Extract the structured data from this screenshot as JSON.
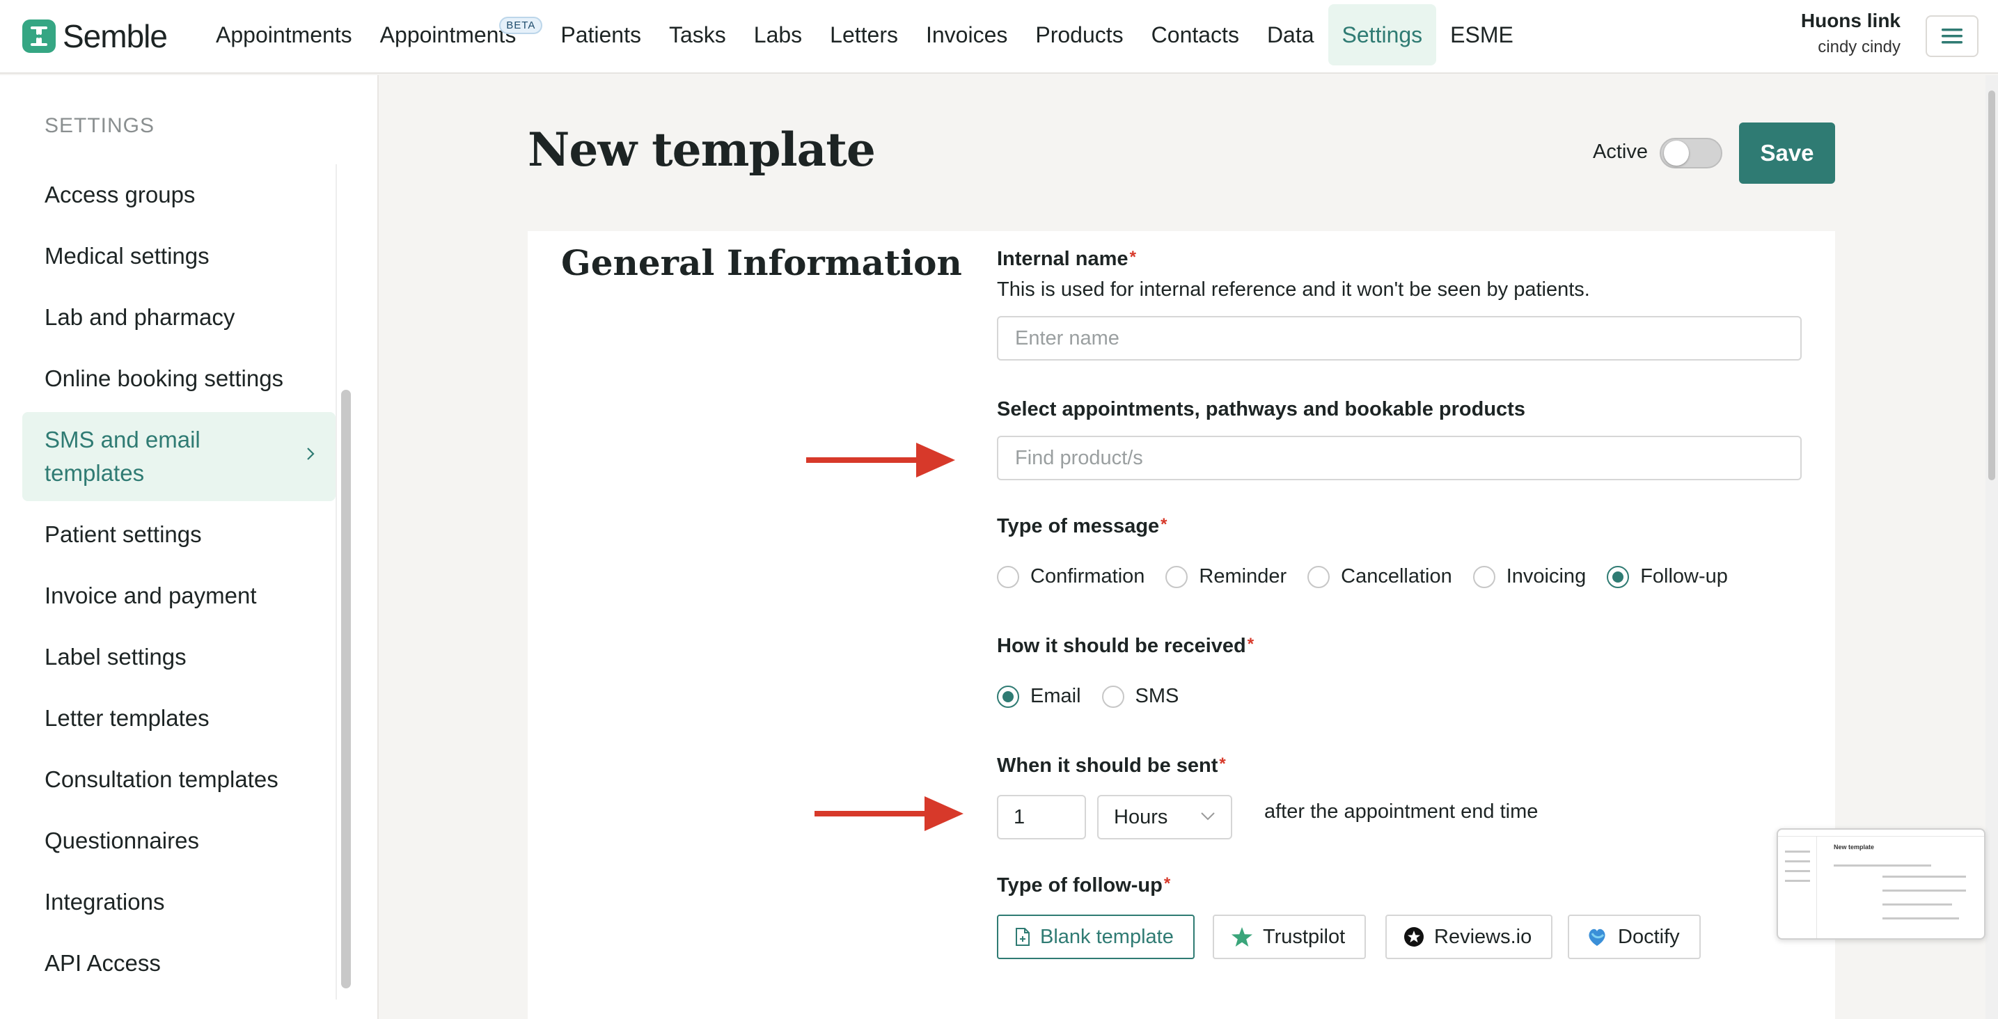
{
  "app": {
    "logo_text": "Semble"
  },
  "nav": {
    "items": [
      {
        "label": "Appointments"
      },
      {
        "label": "Appointments",
        "badge": "BETA"
      },
      {
        "label": "Patients"
      },
      {
        "label": "Tasks"
      },
      {
        "label": "Labs"
      },
      {
        "label": "Letters"
      },
      {
        "label": "Invoices"
      },
      {
        "label": "Products"
      },
      {
        "label": "Contacts"
      },
      {
        "label": "Data"
      },
      {
        "label": "Settings",
        "active": true
      },
      {
        "label": "ESME"
      }
    ],
    "user_org": "Huons link",
    "user_name": "cindy cindy",
    "menu_icon": "hamburger-icon"
  },
  "sidebar": {
    "heading": "SETTINGS",
    "items": [
      {
        "label": "Access groups"
      },
      {
        "label": "Medical settings"
      },
      {
        "label": "Lab and pharmacy"
      },
      {
        "label": "Online booking settings"
      },
      {
        "label": "SMS and email templates",
        "active": true
      },
      {
        "label": "Patient settings"
      },
      {
        "label": "Invoice and payment"
      },
      {
        "label": "Label settings"
      },
      {
        "label": "Letter templates"
      },
      {
        "label": "Consultation templates"
      },
      {
        "label": "Questionnaires"
      },
      {
        "label": "Integrations"
      },
      {
        "label": "API Access"
      }
    ]
  },
  "page": {
    "title": "New template",
    "active_label": "Active",
    "active_on": false,
    "save_label": "Save"
  },
  "form": {
    "section_title": "General Information",
    "internal_name": {
      "label": "Internal name",
      "help": "This is used for internal reference and it won't be seen by patients.",
      "placeholder": "Enter name",
      "value": ""
    },
    "products": {
      "label": "Select appointments, pathways and bookable products",
      "placeholder": "Find product/s"
    },
    "message_type": {
      "label": "Type of message",
      "options": [
        "Confirmation",
        "Reminder",
        "Cancellation",
        "Invoicing",
        "Follow-up"
      ],
      "selected": "Follow-up"
    },
    "received": {
      "label": "How it should be received",
      "options": [
        "Email",
        "SMS"
      ],
      "selected": "Email"
    },
    "when_sent": {
      "label": "When it should be sent",
      "amount": "1",
      "unit": "Hours",
      "suffix": "after the appointment end time"
    },
    "follow_up_type": {
      "label": "Type of follow-up",
      "options": [
        {
          "label": "Blank template",
          "icon": "document-icon",
          "selected": true
        },
        {
          "label": "Trustpilot",
          "icon": "star-icon"
        },
        {
          "label": "Reviews.io",
          "icon": "reviews-star-icon"
        },
        {
          "label": "Doctify",
          "icon": "doctify-icon"
        }
      ]
    },
    "required_mark": "*"
  },
  "colors": {
    "accent": "#2f7b73",
    "accent_bg": "#e9f5ef",
    "required": "#d7392a",
    "arrow": "#d7392a",
    "brand": "#35a683"
  },
  "thumbnail": {
    "title": "New template"
  }
}
